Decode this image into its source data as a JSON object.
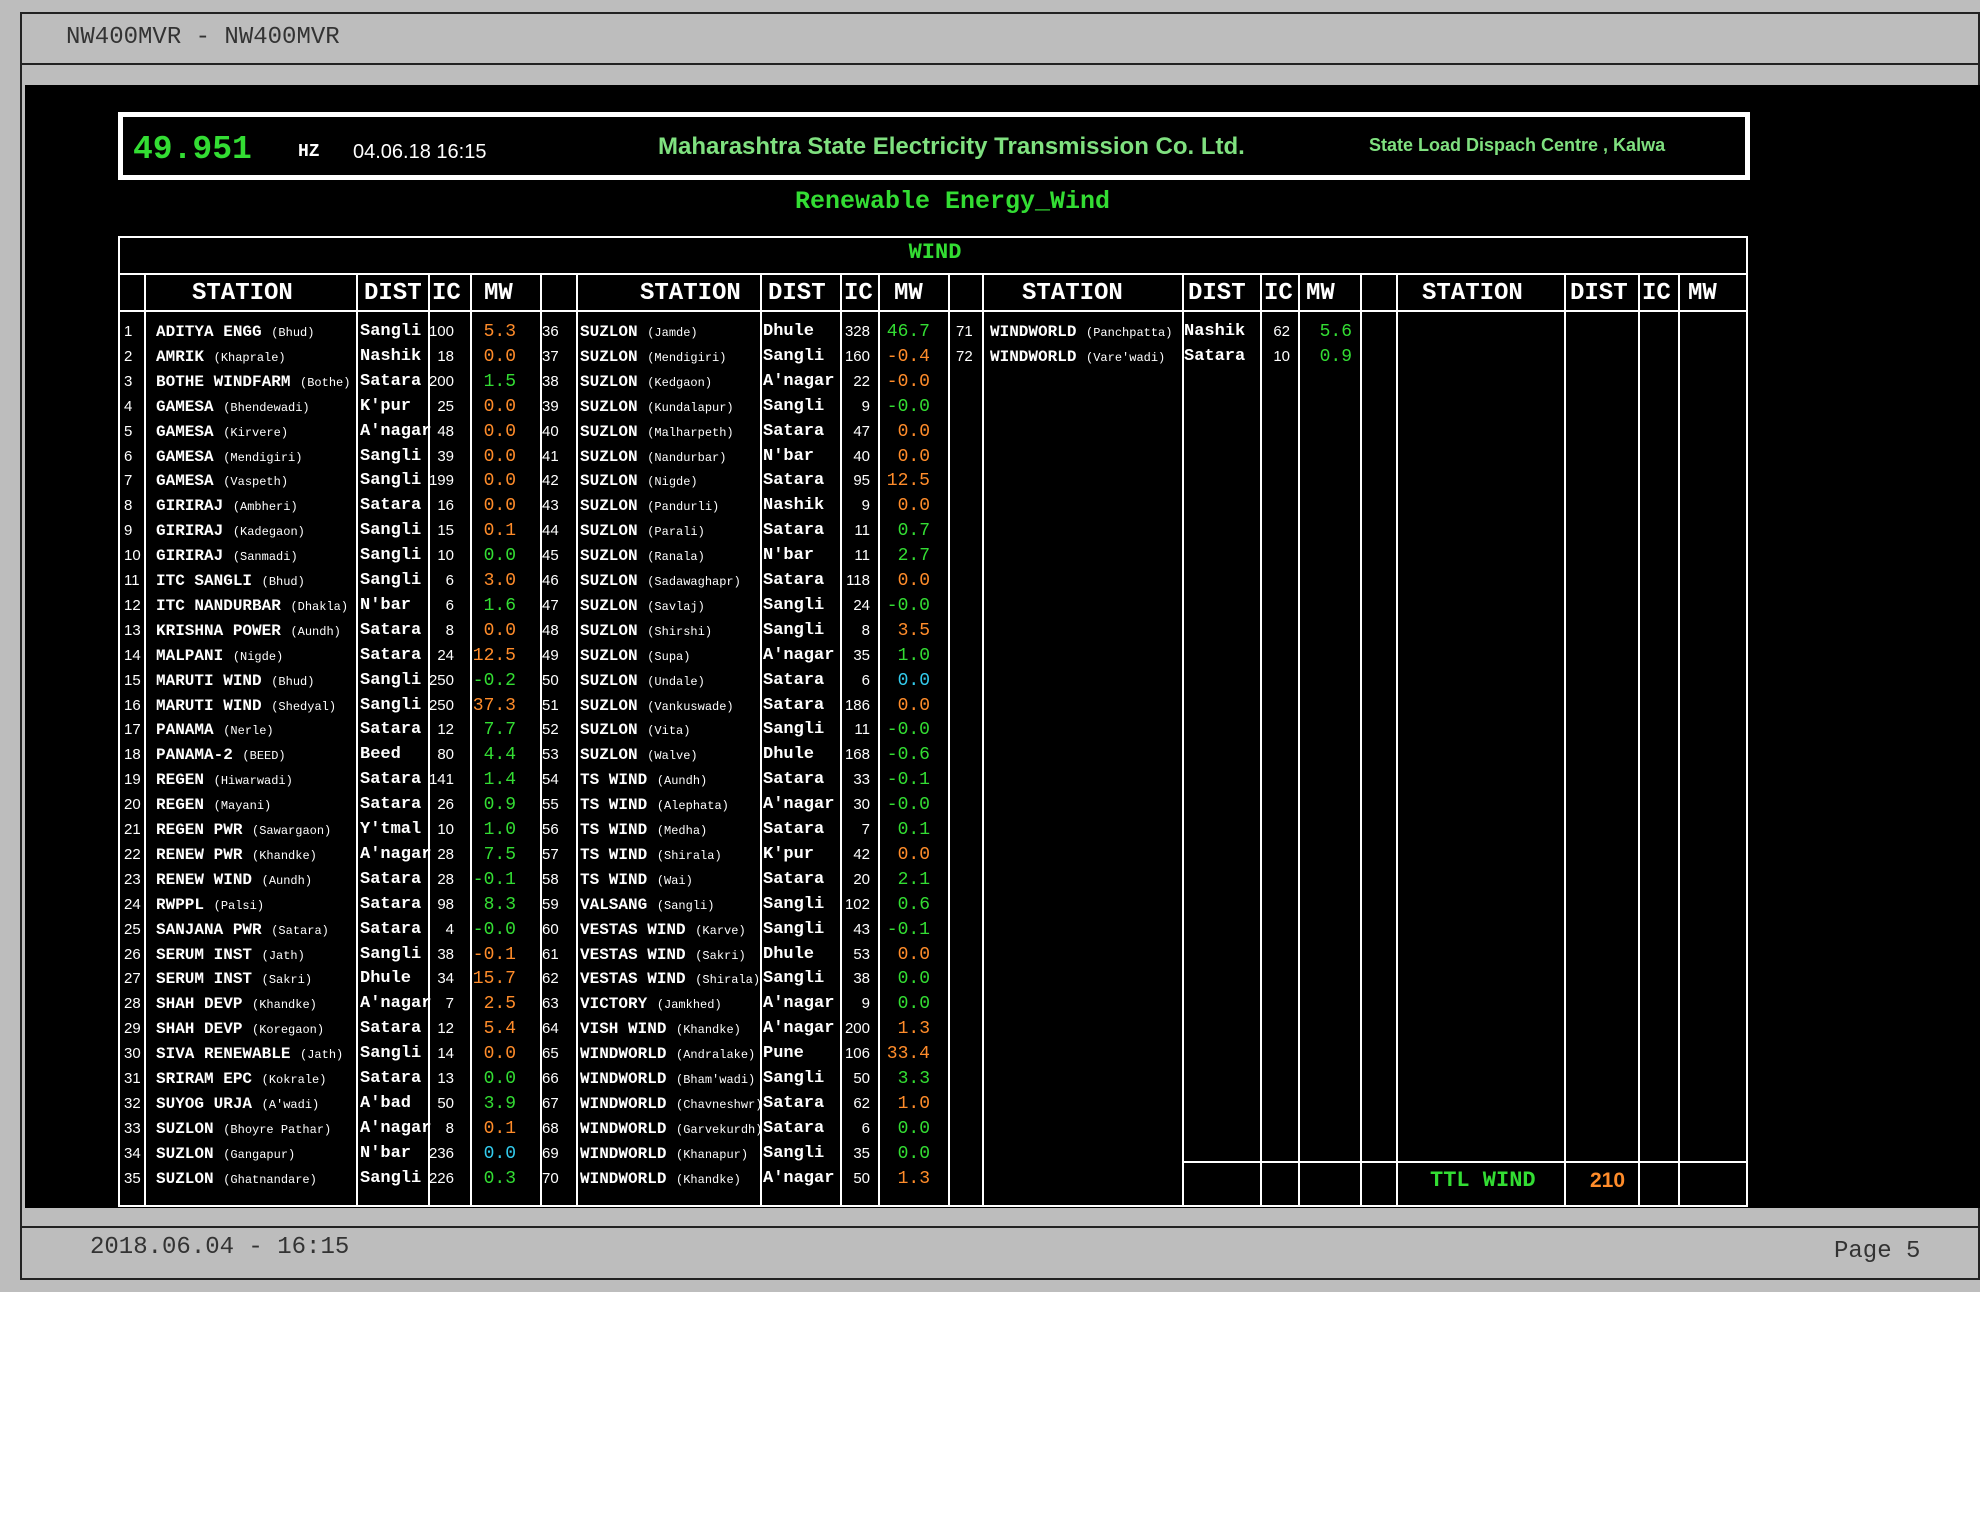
{
  "window": {
    "title": "NW400MVR - NW400MVR"
  },
  "footer": {
    "timestamp": "2018.06.04 - 16:15",
    "page": "Page 5"
  },
  "header": {
    "frequency": "49.951",
    "unit": "HZ",
    "datetime": "04.06.18  16:15",
    "company": "Maharashtra State Electricity Transmission Co. Ltd.",
    "centre": "State Load Dispach Centre , Kalwa"
  },
  "page_title": "Renewable Energy_Wind",
  "table": {
    "section_label": "WIND",
    "headers": {
      "station": "STATION",
      "dist": "DIST",
      "ic": "IC",
      "mw": "MW"
    },
    "colors": {
      "orange": "#ff8c2a",
      "green": "#33dd33",
      "cyan": "#33ccee"
    },
    "col1": [
      {
        "n": "1",
        "name": "ADITYA ENGG",
        "loc": "(Bhud)",
        "dist": "Sangli",
        "ic": "100",
        "mw": "5.3",
        "c": "orange"
      },
      {
        "n": "2",
        "name": "AMRIK",
        "loc": "(Khaprale)",
        "dist": "Nashik",
        "ic": "18",
        "mw": "0.0",
        "c": "orange"
      },
      {
        "n": "3",
        "name": "BOTHE WINDFARM",
        "loc": "(Bothe)",
        "dist": "Satara",
        "ic": "200",
        "mw": "1.5",
        "c": "green"
      },
      {
        "n": "4",
        "name": "GAMESA",
        "loc": "(Bhendewadi)",
        "dist": "K'pur",
        "ic": "25",
        "mw": "0.0",
        "c": "orange"
      },
      {
        "n": "5",
        "name": "GAMESA",
        "loc": "(Kirvere)",
        "dist": "A'nagar",
        "ic": "48",
        "mw": "0.0",
        "c": "orange"
      },
      {
        "n": "6",
        "name": "GAMESA",
        "loc": "(Mendigiri)",
        "dist": "Sangli",
        "ic": "39",
        "mw": "0.0",
        "c": "orange"
      },
      {
        "n": "7",
        "name": "GAMESA",
        "loc": "(Vaspeth)",
        "dist": "Sangli",
        "ic": "199",
        "mw": "0.0",
        "c": "orange"
      },
      {
        "n": "8",
        "name": "GIRIRAJ",
        "loc": "(Ambheri)",
        "dist": "Satara",
        "ic": "16",
        "mw": "0.0",
        "c": "orange"
      },
      {
        "n": "9",
        "name": "GIRIRAJ",
        "loc": "(Kadegaon)",
        "dist": "Sangli",
        "ic": "15",
        "mw": "0.1",
        "c": "orange"
      },
      {
        "n": "10",
        "name": "GIRIRAJ",
        "loc": "(Sanmadi)",
        "dist": "Sangli",
        "ic": "10",
        "mw": "0.0",
        "c": "green"
      },
      {
        "n": "11",
        "name": "ITC SANGLI",
        "loc": "(Bhud)",
        "dist": "Sangli",
        "ic": "6",
        "mw": "3.0",
        "c": "orange"
      },
      {
        "n": "12",
        "name": "ITC NANDURBAR",
        "loc": "(Dhakla)",
        "dist": "N'bar",
        "ic": "6",
        "mw": "1.6",
        "c": "green"
      },
      {
        "n": "13",
        "name": "KRISHNA POWER",
        "loc": "(Aundh)",
        "dist": "Satara",
        "ic": "8",
        "mw": "0.0",
        "c": "orange"
      },
      {
        "n": "14",
        "name": "MALPANI",
        "loc": "(Nigde)",
        "dist": "Satara",
        "ic": "24",
        "mw": "12.5",
        "c": "orange"
      },
      {
        "n": "15",
        "name": "MARUTI WIND",
        "loc": "(Bhud)",
        "dist": "Sangli",
        "ic": "250",
        "mw": "-0.2",
        "c": "green"
      },
      {
        "n": "16",
        "name": "MARUTI WIND",
        "loc": "(Shedyal)",
        "dist": "Sangli",
        "ic": "250",
        "mw": "37.3",
        "c": "orange"
      },
      {
        "n": "17",
        "name": "PANAMA",
        "loc": "(Nerle)",
        "dist": "Satara",
        "ic": "12",
        "mw": "7.7",
        "c": "green"
      },
      {
        "n": "18",
        "name": "PANAMA-2",
        "loc": "(BEED)",
        "dist": "Beed",
        "ic": "80",
        "mw": "4.4",
        "c": "green"
      },
      {
        "n": "19",
        "name": "REGEN",
        "loc": "(Hiwarwadi)",
        "dist": "Satara",
        "ic": "141",
        "mw": "1.4",
        "c": "green"
      },
      {
        "n": "20",
        "name": "REGEN",
        "loc": "(Mayani)",
        "dist": "Satara",
        "ic": "26",
        "mw": "0.9",
        "c": "green"
      },
      {
        "n": "21",
        "name": "REGEN PWR",
        "loc": "(Sawargaon)",
        "dist": "Y'tmal",
        "ic": "10",
        "mw": "1.0",
        "c": "green"
      },
      {
        "n": "22",
        "name": "RENEW PWR",
        "loc": "(Khandke)",
        "dist": "A'nagar",
        "ic": "28",
        "mw": "7.5",
        "c": "green"
      },
      {
        "n": "23",
        "name": "RENEW WIND",
        "loc": "(Aundh)",
        "dist": "Satara",
        "ic": "28",
        "mw": "-0.1",
        "c": "green"
      },
      {
        "n": "24",
        "name": "RWPPL",
        "loc": "(Palsi)",
        "dist": "Satara",
        "ic": "98",
        "mw": "8.3",
        "c": "green"
      },
      {
        "n": "25",
        "name": "SANJANA PWR",
        "loc": "(Satara)",
        "dist": "Satara",
        "ic": "4",
        "mw": "-0.0",
        "c": "green"
      },
      {
        "n": "26",
        "name": "SERUM INST",
        "loc": "(Jath)",
        "dist": "Sangli",
        "ic": "38",
        "mw": "-0.1",
        "c": "orange"
      },
      {
        "n": "27",
        "name": "SERUM INST",
        "loc": "(Sakri)",
        "dist": "Dhule",
        "ic": "34",
        "mw": "15.7",
        "c": "orange"
      },
      {
        "n": "28",
        "name": "SHAH DEVP",
        "loc": "(Khandke)",
        "dist": "A'nagar",
        "ic": "7",
        "mw": "2.5",
        "c": "orange"
      },
      {
        "n": "29",
        "name": "SHAH DEVP",
        "loc": "(Koregaon)",
        "dist": "Satara",
        "ic": "12",
        "mw": "5.4",
        "c": "orange"
      },
      {
        "n": "30",
        "name": "SIVA RENEWABLE",
        "loc": "(Jath)",
        "dist": "Sangli",
        "ic": "14",
        "mw": "0.0",
        "c": "orange"
      },
      {
        "n": "31",
        "name": "SRIRAM EPC",
        "loc": "(Kokrale)",
        "dist": "Satara",
        "ic": "13",
        "mw": "0.0",
        "c": "green"
      },
      {
        "n": "32",
        "name": "SUYOG URJA",
        "loc": "(A'wadi)",
        "dist": "A'bad",
        "ic": "50",
        "mw": "3.9",
        "c": "green"
      },
      {
        "n": "33",
        "name": "SUZLON",
        "loc": "(Bhoyre Pathar)",
        "dist": "A'nagar",
        "ic": "8",
        "mw": "0.1",
        "c": "orange"
      },
      {
        "n": "34",
        "name": "SUZLON",
        "loc": "(Gangapur)",
        "dist": "N'bar",
        "ic": "236",
        "mw": "0.0",
        "c": "cyan"
      },
      {
        "n": "35",
        "name": "SUZLON",
        "loc": "(Ghatnandare)",
        "dist": "Sangli",
        "ic": "226",
        "mw": "0.3",
        "c": "green"
      }
    ],
    "col2": [
      {
        "n": "36",
        "name": "SUZLON",
        "loc": "(Jamde)",
        "dist": "Dhule",
        "ic": "328",
        "mw": "46.7",
        "c": "green"
      },
      {
        "n": "37",
        "name": "SUZLON",
        "loc": "(Mendigiri)",
        "dist": "Sangli",
        "ic": "160",
        "mw": "-0.4",
        "c": "orange"
      },
      {
        "n": "38",
        "name": "SUZLON",
        "loc": "(Kedgaon)",
        "dist": "A'nagar",
        "ic": "22",
        "mw": "-0.0",
        "c": "orange"
      },
      {
        "n": "39",
        "name": "SUZLON",
        "loc": "(Kundalapur)",
        "dist": "Sangli",
        "ic": "9",
        "mw": "-0.0",
        "c": "green"
      },
      {
        "n": "40",
        "name": "SUZLON",
        "loc": "(Malharpeth)",
        "dist": "Satara",
        "ic": "47",
        "mw": "0.0",
        "c": "orange"
      },
      {
        "n": "41",
        "name": "SUZLON",
        "loc": "(Nandurbar)",
        "dist": "N'bar",
        "ic": "40",
        "mw": "0.0",
        "c": "orange"
      },
      {
        "n": "42",
        "name": "SUZLON",
        "loc": "(Nigde)",
        "dist": "Satara",
        "ic": "95",
        "mw": "12.5",
        "c": "orange"
      },
      {
        "n": "43",
        "name": "SUZLON",
        "loc": "(Pandurli)",
        "dist": "Nashik",
        "ic": "9",
        "mw": "0.0",
        "c": "orange"
      },
      {
        "n": "44",
        "name": "SUZLON",
        "loc": "(Parali)",
        "dist": "Satara",
        "ic": "11",
        "mw": "0.7",
        "c": "green"
      },
      {
        "n": "45",
        "name": "SUZLON",
        "loc": "(Ranala)",
        "dist": "N'bar",
        "ic": "11",
        "mw": "2.7",
        "c": "green"
      },
      {
        "n": "46",
        "name": "SUZLON",
        "loc": "(Sadawaghapr)",
        "dist": "Satara",
        "ic": "118",
        "mw": "0.0",
        "c": "orange"
      },
      {
        "n": "47",
        "name": "SUZLON",
        "loc": "(Savlaj)",
        "dist": "Sangli",
        "ic": "24",
        "mw": "-0.0",
        "c": "green"
      },
      {
        "n": "48",
        "name": "SUZLON",
        "loc": "(Shirshi)",
        "dist": "Sangli",
        "ic": "8",
        "mw": "3.5",
        "c": "orange"
      },
      {
        "n": "49",
        "name": "SUZLON",
        "loc": "(Supa)",
        "dist": "A'nagar",
        "ic": "35",
        "mw": "1.0",
        "c": "green"
      },
      {
        "n": "50",
        "name": "SUZLON",
        "loc": "(Undale)",
        "dist": "Satara",
        "ic": "6",
        "mw": "0.0",
        "c": "cyan"
      },
      {
        "n": "51",
        "name": "SUZLON",
        "loc": "(Vankuswade)",
        "dist": "Satara",
        "ic": "186",
        "mw": "0.0",
        "c": "orange"
      },
      {
        "n": "52",
        "name": "SUZLON",
        "loc": "(Vita)",
        "dist": "Sangli",
        "ic": "11",
        "mw": "-0.0",
        "c": "green"
      },
      {
        "n": "53",
        "name": "SUZLON",
        "loc": "(Walve)",
        "dist": "Dhule",
        "ic": "168",
        "mw": "-0.6",
        "c": "green"
      },
      {
        "n": "54",
        "name": "TS WIND",
        "loc": "(Aundh)",
        "dist": "Satara",
        "ic": "33",
        "mw": "-0.1",
        "c": "green"
      },
      {
        "n": "55",
        "name": "TS WIND",
        "loc": "(Alephata)",
        "dist": "A'nagar",
        "ic": "30",
        "mw": "-0.0",
        "c": "green"
      },
      {
        "n": "56",
        "name": "TS WIND",
        "loc": "(Medha)",
        "dist": "Satara",
        "ic": "7",
        "mw": "0.1",
        "c": "green"
      },
      {
        "n": "57",
        "name": "TS WIND",
        "loc": "(Shirala)",
        "dist": "K'pur",
        "ic": "42",
        "mw": "0.0",
        "c": "orange"
      },
      {
        "n": "58",
        "name": "TS WIND",
        "loc": "(Wai)",
        "dist": "Satara",
        "ic": "20",
        "mw": "2.1",
        "c": "green"
      },
      {
        "n": "59",
        "name": "VALSANG",
        "loc": "(Sangli)",
        "dist": "Sangli",
        "ic": "102",
        "mw": "0.6",
        "c": "green"
      },
      {
        "n": "60",
        "name": "VESTAS WIND",
        "loc": "(Karve)",
        "dist": "Sangli",
        "ic": "43",
        "mw": "-0.1",
        "c": "green"
      },
      {
        "n": "61",
        "name": "VESTAS WIND",
        "loc": "(Sakri)",
        "dist": "Dhule",
        "ic": "53",
        "mw": "0.0",
        "c": "orange"
      },
      {
        "n": "62",
        "name": "VESTAS WIND",
        "loc": "(Shirala)",
        "dist": "Sangli",
        "ic": "38",
        "mw": "0.0",
        "c": "green"
      },
      {
        "n": "63",
        "name": "VICTORY",
        "loc": "(Jamkhed)",
        "dist": "A'nagar",
        "ic": "9",
        "mw": "0.0",
        "c": "green"
      },
      {
        "n": "64",
        "name": "VISH WIND",
        "loc": "(Khandke)",
        "dist": "A'nagar",
        "ic": "200",
        "mw": "1.3",
        "c": "orange"
      },
      {
        "n": "65",
        "name": "WINDWORLD",
        "loc": "(Andralake)",
        "dist": "Pune",
        "ic": "106",
        "mw": "33.4",
        "c": "orange"
      },
      {
        "n": "66",
        "name": "WINDWORLD",
        "loc": "(Bham'wadi)",
        "dist": "Sangli",
        "ic": "50",
        "mw": "3.3",
        "c": "green"
      },
      {
        "n": "67",
        "name": "WINDWORLD",
        "loc": "(Chavneshwr)",
        "dist": "Satara",
        "ic": "62",
        "mw": "1.0",
        "c": "orange"
      },
      {
        "n": "68",
        "name": "WINDWORLD",
        "loc": "(Garvekurdh)",
        "dist": "Satara",
        "ic": "6",
        "mw": "0.0",
        "c": "green"
      },
      {
        "n": "69",
        "name": "WINDWORLD",
        "loc": "(Khanapur)",
        "dist": "Sangli",
        "ic": "35",
        "mw": "0.0",
        "c": "green"
      },
      {
        "n": "70",
        "name": "WINDWORLD",
        "loc": "(Khandke)",
        "dist": "A'nagar",
        "ic": "50",
        "mw": "1.3",
        "c": "orange"
      }
    ],
    "col3": [
      {
        "n": "71",
        "name": "WINDWORLD",
        "loc": "(Panchpatta)",
        "dist": "Nashik",
        "ic": "62",
        "mw": "5.6",
        "c": "green"
      },
      {
        "n": "72",
        "name": "WINDWORLD",
        "loc": "(Vare'wadi)",
        "dist": "Satara",
        "ic": "10",
        "mw": "0.9",
        "c": "green"
      }
    ],
    "total": {
      "label": "TTL WIND",
      "value": "210"
    }
  }
}
